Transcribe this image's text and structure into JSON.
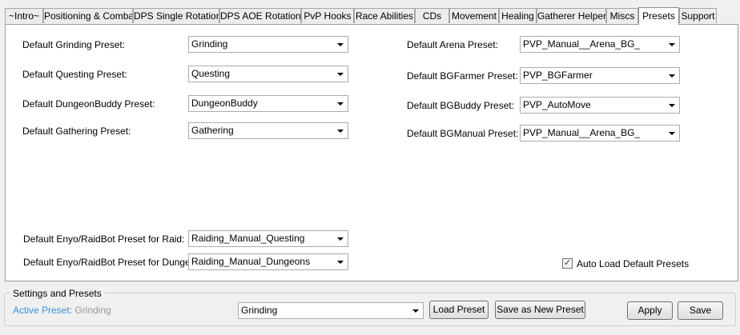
{
  "tabs": [
    {
      "label": "~Intro~",
      "active": false
    },
    {
      "label": "Positioning & Combat",
      "active": false
    },
    {
      "label": "DPS Single Rotation",
      "active": false
    },
    {
      "label": "DPS AOE Rotation",
      "active": false
    },
    {
      "label": "PvP Hooks",
      "active": false
    },
    {
      "label": "Race Abilities",
      "active": false
    },
    {
      "label": "CDs",
      "active": false
    },
    {
      "label": "Movement",
      "active": false
    },
    {
      "label": "Healing",
      "active": false
    },
    {
      "label": "Gatherer Helper",
      "active": false
    },
    {
      "label": "Miscs",
      "active": false
    },
    {
      "label": "Presets",
      "active": true
    },
    {
      "label": "Support",
      "active": false
    }
  ],
  "presets": {
    "grinding": {
      "label": "Default Grinding Preset:",
      "value": "Grinding"
    },
    "questing": {
      "label": "Default Questing Preset:",
      "value": "Questing"
    },
    "dungeonbuddy": {
      "label": "Default DungeonBuddy Preset:",
      "value": "DungeonBuddy"
    },
    "gathering": {
      "label": "Default Gathering Preset:",
      "value": "Gathering"
    },
    "arena": {
      "label": "Default Arena Preset:",
      "value": "PVP_Manual__Arena_BG_"
    },
    "bgfarmer": {
      "label": "Default BGFarmer Preset:",
      "value": "PVP_BGFarmer"
    },
    "bgbuddy": {
      "label": "Default BGBuddy Preset:",
      "value": "PVP_AutoMove"
    },
    "bgmanual": {
      "label": "Default BGManual Preset:",
      "value": "PVP_Manual__Arena_BG_"
    },
    "raid": {
      "label": "Default Enyo/RaidBot Preset for Raid:",
      "value": "Raiding_Manual_Questing"
    },
    "dungeon": {
      "label": "Default Enyo/RaidBot Preset for Dungeon:",
      "value": "Raiding_Manual_Dungeons"
    }
  },
  "auto_load": {
    "label": "Auto Load Default Presets",
    "checked": true
  },
  "settings": {
    "group_title": "Settings and Presets",
    "active_preset_key": "Active Preset:",
    "active_preset_value": "Grinding",
    "preset_select_value": "Grinding",
    "load_button": "Load Preset",
    "save_new_button": "Save as New Preset",
    "apply_button": "Apply",
    "save_button": "Save"
  },
  "colors": {
    "active_preset_key": "#3b8fd6",
    "active_preset_value": "#9a9a9a"
  }
}
